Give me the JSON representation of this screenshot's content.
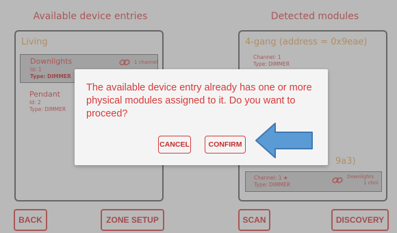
{
  "left_column": {
    "title": "Available device entries",
    "zone_name": "Living",
    "entries": [
      {
        "name": "Downlights",
        "id_label": "Id:",
        "id_value": "1",
        "type_label": "Type:",
        "type_value": "DIMMER",
        "link_text": "1 channel",
        "selected": true
      },
      {
        "name": "Pendant",
        "id_label": "Id:",
        "id_value": "2",
        "type_label": "Type:",
        "type_value": "DIMMER",
        "selected": false
      }
    ]
  },
  "right_column": {
    "title": "Detected modules",
    "module_name": "4-gang (address = 0x9eae)",
    "channels": [
      {
        "channel_label": "Channel:",
        "channel_value": "1",
        "type_label": "Type:",
        "type_value": "DIMMER"
      }
    ],
    "second_module_suffix": "9a3)",
    "assigned_channel": {
      "channel_label": "Channel:",
      "channel_value": "1",
      "star": "★",
      "type_label": "Type:",
      "type_value": "DIMMER",
      "link_text": "Downlights",
      "link_sub": "1 chnl"
    }
  },
  "buttons": {
    "back": "BACK",
    "zone_setup": "ZONE SETUP",
    "scan": "SCAN",
    "discovery": "DISCOVERY"
  },
  "dialog": {
    "message": "The available device entry already has one or more physical modules assigned to it. Do you want to proceed?",
    "cancel": "CANCEL",
    "confirm": "CONFIRM"
  },
  "annotation": {
    "arrow_color": "#5b9bd5",
    "arrow_outline": "#3f78b0",
    "icon": "arrow-left-icon"
  },
  "colors": {
    "accent_red": "#d64545",
    "zone_orange": "#e0a55f",
    "background": "#efefef"
  }
}
